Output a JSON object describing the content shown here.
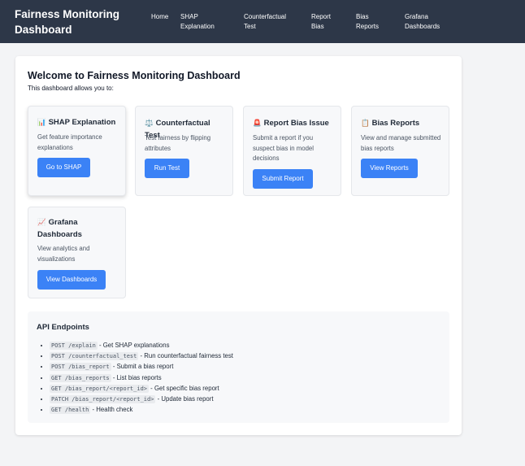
{
  "header": {
    "title": "Fairness Monitoring Dashboard",
    "nav": [
      {
        "line1": "Home",
        "line2": ""
      },
      {
        "line1": "SHAP",
        "line2": "Explanation"
      },
      {
        "line1": "Counterfactual",
        "line2": "Test"
      },
      {
        "line1": "Report",
        "line2": "Bias"
      },
      {
        "line1": "Bias",
        "line2": "Reports"
      },
      {
        "line1": "Grafana",
        "line2": "Dashboards"
      }
    ]
  },
  "main": {
    "title": "Welcome to Fairness Monitoring Dashboard",
    "subtitle": "This dashboard allows you to:",
    "cards": [
      {
        "icon": "📊",
        "icon_name": "bar-chart-icon",
        "title": "SHAP Explanation",
        "desc": "Get feature importance explanations",
        "button": "Go to SHAP"
      },
      {
        "icon": "⚖️",
        "icon_name": "scales-icon",
        "title": "Counterfactual Test",
        "desc": "Test fairness by flipping attributes",
        "button": "Run Test"
      },
      {
        "icon": "🚨",
        "icon_name": "alert-siren-icon",
        "title": "Report Bias Issue",
        "desc": "Submit a report if you suspect bias in model decisions",
        "button": "Submit Report"
      },
      {
        "icon": "📋",
        "icon_name": "clipboard-icon",
        "title": "Bias Reports",
        "desc": "View and manage submitted bias reports",
        "button": "View Reports"
      },
      {
        "icon": "📈",
        "icon_name": "line-chart-icon",
        "title": "Grafana Dashboards",
        "desc": "View analytics and visualizations",
        "button": "View Dashboards"
      }
    ],
    "api": {
      "title": "API Endpoints",
      "endpoints": [
        {
          "code": "POST /explain",
          "desc": " - Get SHAP explanations"
        },
        {
          "code": "POST /counterfactual_test",
          "desc": " - Run counterfactual fairness test"
        },
        {
          "code": "POST /bias_report",
          "desc": " - Submit a bias report"
        },
        {
          "code": "GET /bias_reports",
          "desc": " - List bias reports"
        },
        {
          "code": "GET /bias_report/<report_id>",
          "desc": " - Get specific bias report"
        },
        {
          "code": "PATCH /bias_report/<report_id>",
          "desc": " - Update bias report"
        },
        {
          "code": "GET /health",
          "desc": " - Health check"
        }
      ]
    }
  },
  "colors": {
    "header_bg": "#2d3748",
    "page_bg": "#f3f4f6",
    "card_bg": "#f7f8fa",
    "button": "#3b82f6"
  }
}
